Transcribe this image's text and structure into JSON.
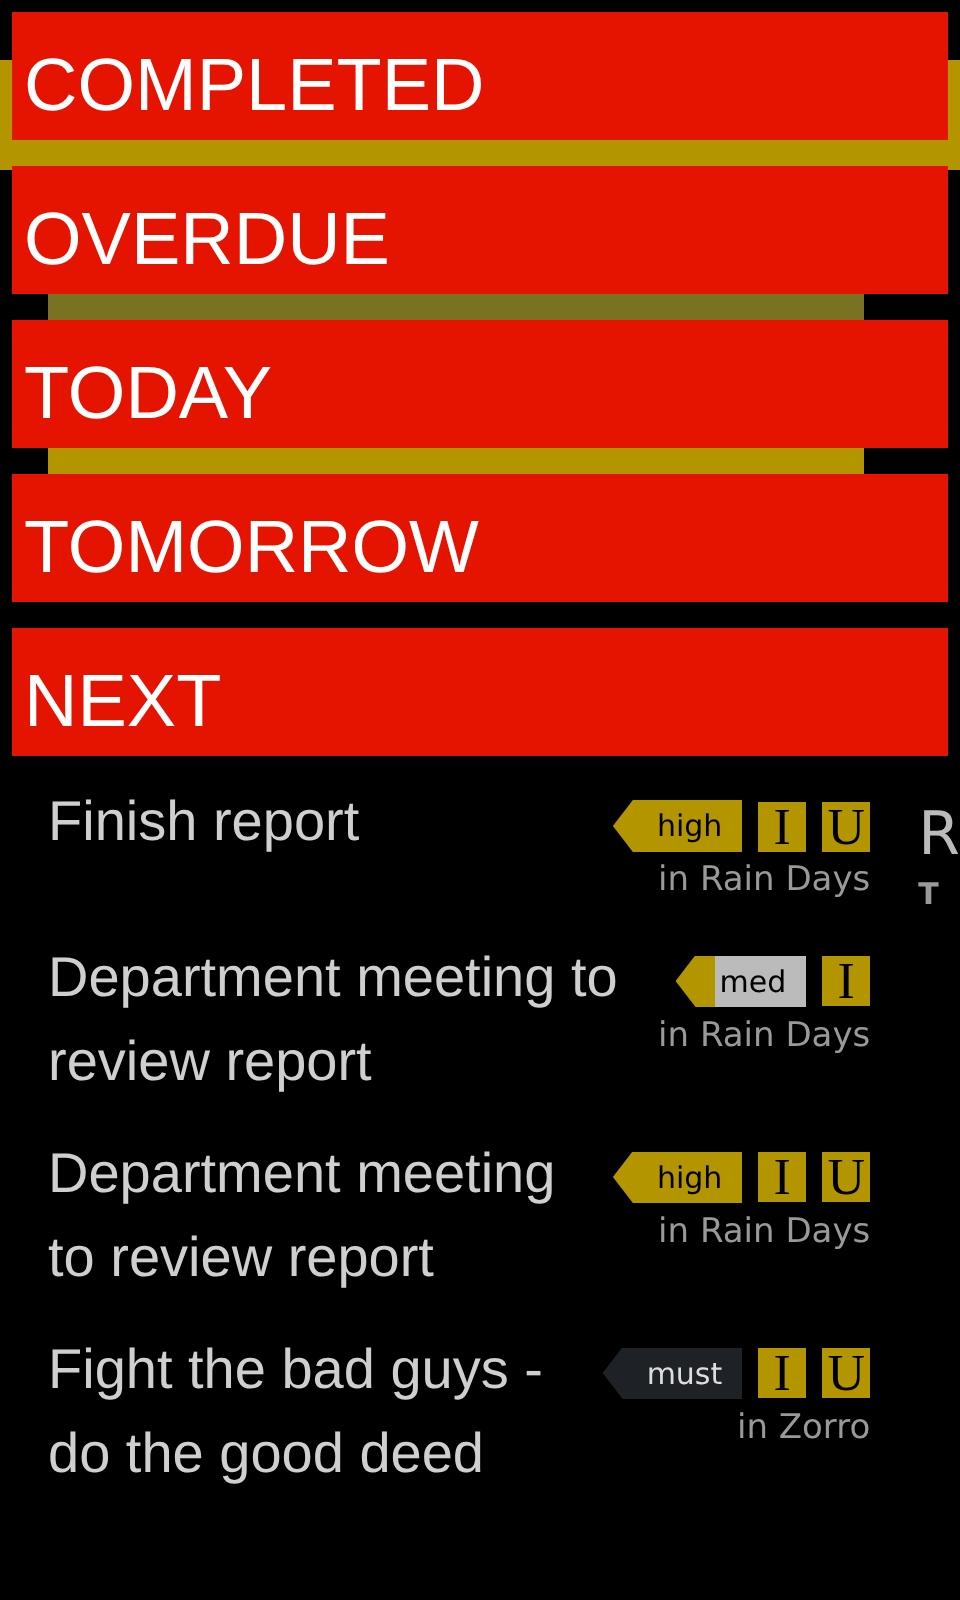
{
  "menu": [
    {
      "label": "COMPLETED"
    },
    {
      "label": "OVERDUE"
    },
    {
      "label": "TODAY"
    },
    {
      "label": "TOMORROW"
    },
    {
      "label": "NEXT"
    }
  ],
  "tasks": [
    {
      "title": "Finish report",
      "priority": {
        "kind": "high",
        "label": "high"
      },
      "flags": [
        "I",
        "U"
      ],
      "folder": "in Rain Days"
    },
    {
      "title": "Department meeting to review report",
      "priority": {
        "kind": "med",
        "label": "med"
      },
      "flags": [
        "I"
      ],
      "folder": "in Rain Days"
    },
    {
      "title": "Department meeting to review report",
      "priority": {
        "kind": "high",
        "label": "high"
      },
      "flags": [
        "I",
        "U"
      ],
      "folder": "in Rain Days"
    },
    {
      "title": "Fight the bad guys - do the good deed",
      "priority": {
        "kind": "must",
        "label": "must"
      },
      "flags": [
        "I",
        "U"
      ],
      "folder": "in Zorro"
    }
  ],
  "next_panel": {
    "title": "R",
    "subtitle": "T"
  }
}
